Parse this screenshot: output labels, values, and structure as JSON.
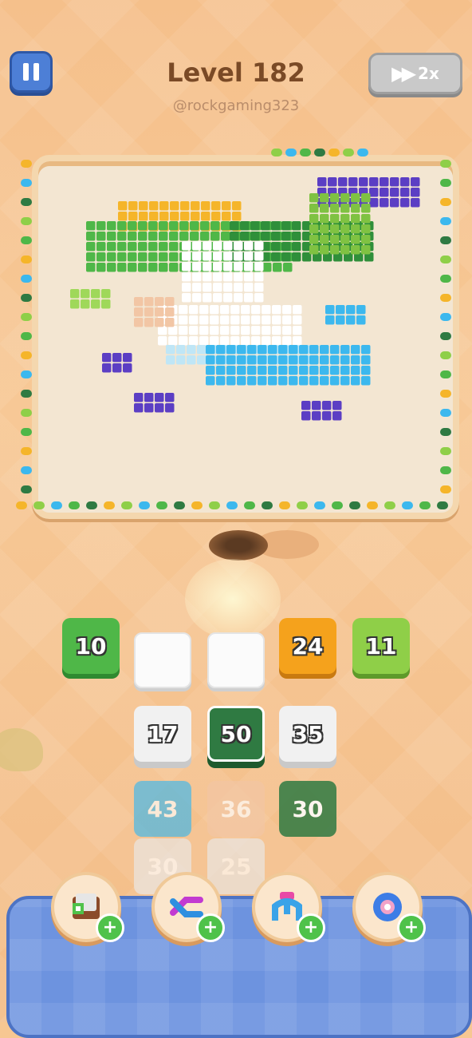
{
  "header": {
    "level_title": "Level 182",
    "creator": "@rockgaming323",
    "speed_label": "2x"
  },
  "slots": [
    "10",
    "",
    "",
    "24",
    "11"
  ],
  "stacks": [
    "17",
    "50",
    "35",
    "43",
    "36",
    "30",
    "30",
    "25"
  ],
  "colors": {
    "background": "#f7c792",
    "board": "#f3e6d2",
    "pause_button": "#4d7fd6",
    "tray": "#6d93df",
    "green": "#4fb748",
    "dark_green": "#2f7a42",
    "orange": "#f5a21c",
    "lime": "#8fcf48",
    "sky_blue": "#3cb8ee",
    "peach": "#f2c6a5",
    "white": "#f1f1f1",
    "purple": "#5b3ec4",
    "yellow": "#f5b52a"
  },
  "icons": [
    "pause-icon",
    "fast-forward-icon",
    "add-box-icon",
    "shuffle-icon",
    "claw-icon",
    "gear-flower-icon",
    "plus-icon"
  ]
}
